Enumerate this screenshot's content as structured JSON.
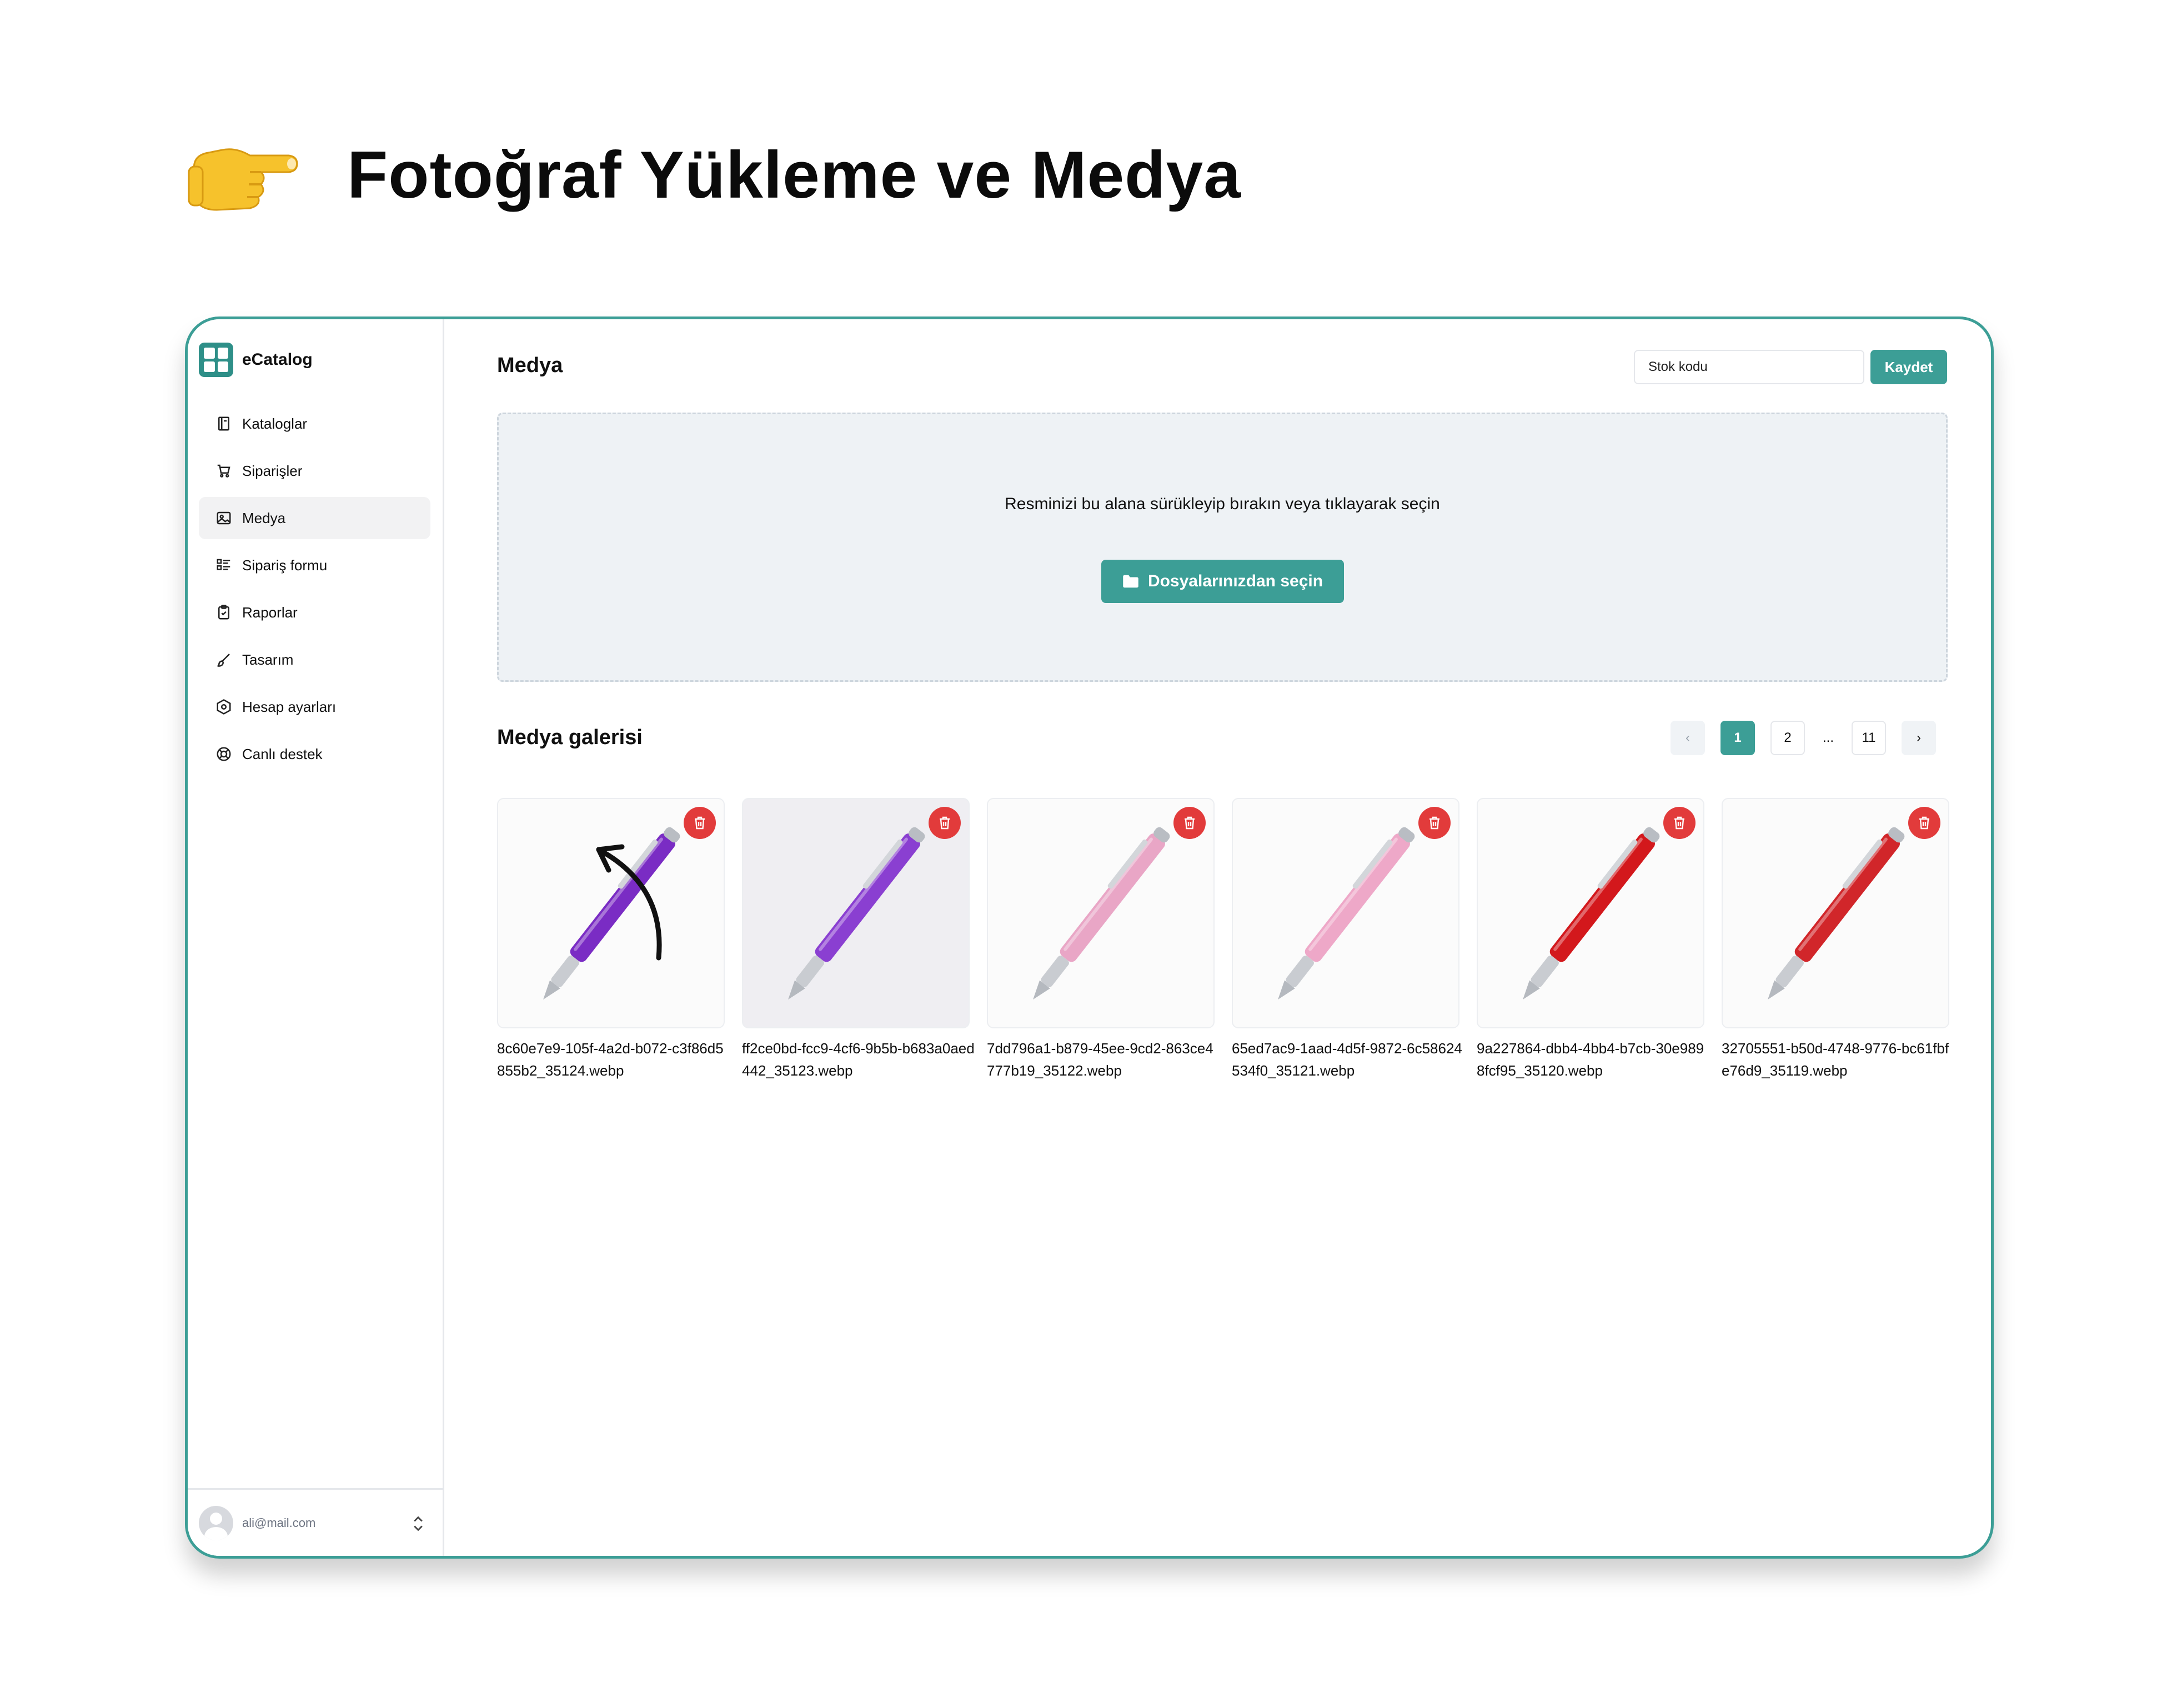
{
  "hero": {
    "title": "Fotoğraf Yükleme ve Medya",
    "icon": "pointing-hand-icon"
  },
  "sidebar": {
    "brand": "eCatalog",
    "items": [
      {
        "label": "Kataloglar",
        "icon": "book-icon",
        "active": false
      },
      {
        "label": "Siparişler",
        "icon": "cart-icon",
        "active": false
      },
      {
        "label": "Medya",
        "icon": "image-icon",
        "active": true
      },
      {
        "label": "Sipariş formu",
        "icon": "form-list-icon",
        "active": false
      },
      {
        "label": "Raporlar",
        "icon": "clipboard-icon",
        "active": false
      },
      {
        "label": "Tasarım",
        "icon": "brush-icon",
        "active": false
      },
      {
        "label": "Hesap ayarları",
        "icon": "settings-hex-icon",
        "active": false
      },
      {
        "label": "Canlı destek",
        "icon": "lifebuoy-icon",
        "active": false
      }
    ],
    "user_email": "ali@mail.com"
  },
  "main": {
    "title": "Medya",
    "stock_placeholder": "Stok kodu",
    "save_label": "Kaydet",
    "dropzone_text": "Resminizi bu alana sürükleyip bırakın veya tıklayarak seçin",
    "choose_label": "Dosyalarınızdan seçin",
    "gallery_title": "Medya galerisi",
    "pagination": {
      "pages": [
        "1",
        "2",
        "...",
        "11"
      ],
      "current": "1",
      "prev": "‹",
      "next": "›"
    },
    "images": [
      {
        "filename": "8c60e7e9-105f-4a2d-b072-c3f86d5855b2_35124.webp",
        "pen_color": "#7a2cc4"
      },
      {
        "filename": "ff2ce0bd-fcc9-4cf6-9b5b-b683a0aed442_35123.webp",
        "pen_color": "#8a3fd1"
      },
      {
        "filename": "7dd796a1-b879-45ee-9cd2-863ce4777b19_35122.webp",
        "pen_color": "#e9a6c6"
      },
      {
        "filename": "65ed7ac9-1aad-4d5f-9872-6c58624534f0_35121.webp",
        "pen_color": "#eea8c8"
      },
      {
        "filename": "9a227864-dbb4-4bb4-b7cb-30e9898fcf95_35120.webp",
        "pen_color": "#d3181c"
      },
      {
        "filename": "32705551-b50d-4748-9776-bc61fbfe76d9_35119.webp",
        "pen_color": "#d1262a"
      }
    ]
  },
  "colors": {
    "accent": "#3c9e96",
    "danger": "#e23b3b",
    "dropzone_bg": "#eef2f5"
  }
}
